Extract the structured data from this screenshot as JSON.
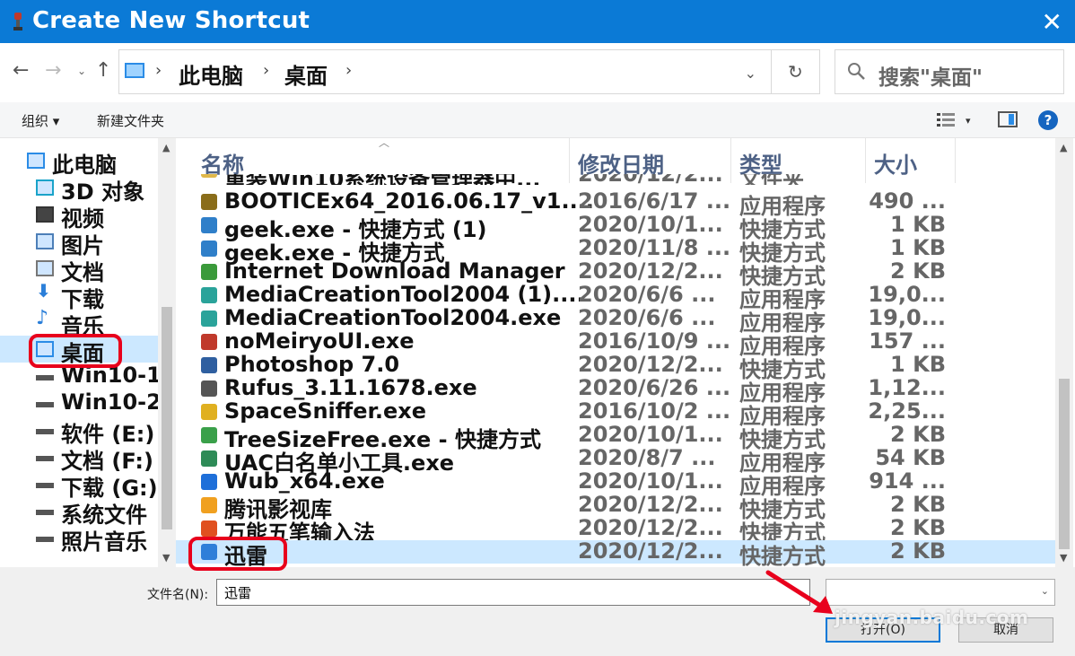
{
  "window": {
    "title": "Create New Shortcut",
    "close_glyph": "✕"
  },
  "nav": {
    "back_glyph": "←",
    "forward_glyph": "→",
    "recent_glyph": "⌄",
    "up_glyph": "↑",
    "breadcrumb": [
      "此电脑",
      "桌面"
    ],
    "sep_glyph": "›",
    "address_dropdown_glyph": "⌄",
    "refresh_glyph": "↻",
    "search_placeholder": "搜索\"桌面\""
  },
  "toolbar": {
    "organize_label": "组织 ▾",
    "new_folder_label": "新建文件夹",
    "view_drop_glyph": "▾",
    "help_glyph": "?"
  },
  "tree": {
    "items": [
      {
        "label": "此电脑",
        "icon": "pc-icon",
        "root": true
      },
      {
        "label": "3D 对象",
        "icon": "3d-objects-icon"
      },
      {
        "label": "视频",
        "icon": "video-icon"
      },
      {
        "label": "图片",
        "icon": "pictures-icon"
      },
      {
        "label": "文档",
        "icon": "documents-icon"
      },
      {
        "label": "下载",
        "icon": "download-icon"
      },
      {
        "label": "音乐",
        "icon": "music-icon"
      },
      {
        "label": "桌面",
        "icon": "desktop-icon",
        "selected": true
      },
      {
        "label": "Win10-1",
        "icon": "drive-icon"
      },
      {
        "label": "Win10-2",
        "icon": "drive-icon"
      },
      {
        "label": "软件 (E:)",
        "icon": "drive-icon"
      },
      {
        "label": "文档 (F:)",
        "icon": "drive-icon"
      },
      {
        "label": "下载 (G:)",
        "icon": "drive-icon"
      },
      {
        "label": "系统文件",
        "icon": "drive-icon"
      },
      {
        "label": "照片音乐",
        "icon": "drive-icon"
      }
    ]
  },
  "list": {
    "columns": [
      "名称",
      "修改日期",
      "类型",
      "大小"
    ],
    "partial_row": {
      "name": "重装Win10系统设备管理器中...",
      "date": "2020/12/2...",
      "type": "文件夹"
    },
    "rows": [
      {
        "name": "BOOTICEx64_2016.06.17_v1....",
        "date": "2016/6/17 ...",
        "type": "应用程序",
        "size": "490 ...",
        "color": "#8a6d1a"
      },
      {
        "name": "geek.exe - 快捷方式 (1)",
        "date": "2020/10/1...",
        "type": "快捷方式",
        "size": "1 KB",
        "color": "#2f7fc9"
      },
      {
        "name": "geek.exe - 快捷方式",
        "date": "2020/11/8 ...",
        "type": "快捷方式",
        "size": "1 KB",
        "color": "#2f7fc9"
      },
      {
        "name": "Internet Download Manager",
        "date": "2020/12/2...",
        "type": "快捷方式",
        "size": "2 KB",
        "color": "#3a9a3a"
      },
      {
        "name": "MediaCreationTool2004 (1)....",
        "date": "2020/6/6 ...",
        "type": "应用程序",
        "size": "19,0...",
        "color": "#2aa39a"
      },
      {
        "name": "MediaCreationTool2004.exe",
        "date": "2020/6/6 ...",
        "type": "应用程序",
        "size": "19,0...",
        "color": "#2aa39a"
      },
      {
        "name": "noMeiryoUI.exe",
        "date": "2016/10/9 ...",
        "type": "应用程序",
        "size": "157 ...",
        "color": "#c0392b"
      },
      {
        "name": "Photoshop 7.0",
        "date": "2020/12/2...",
        "type": "快捷方式",
        "size": "1 KB",
        "color": "#2f5fa0"
      },
      {
        "name": "Rufus_3.11.1678.exe",
        "date": "2020/6/26 ...",
        "type": "应用程序",
        "size": "1,12...",
        "color": "#555555"
      },
      {
        "name": "SpaceSniffer.exe",
        "date": "2016/10/2 ...",
        "type": "应用程序",
        "size": "2,25...",
        "color": "#e0b020"
      },
      {
        "name": "TreeSizeFree.exe - 快捷方式",
        "date": "2020/10/1...",
        "type": "快捷方式",
        "size": "2 KB",
        "color": "#3aa04a"
      },
      {
        "name": "UAC白名单小工具.exe",
        "date": "2020/8/7 ...",
        "type": "应用程序",
        "size": "54 KB",
        "color": "#2e8b57"
      },
      {
        "name": "Wub_x64.exe",
        "date": "2020/10/1...",
        "type": "应用程序",
        "size": "914 ...",
        "color": "#1e6fd9"
      },
      {
        "name": "腾讯影视库",
        "date": "2020/12/2...",
        "type": "快捷方式",
        "size": "2 KB",
        "color": "#f0a020"
      },
      {
        "name": "万能五笔输入法",
        "date": "2020/12/2...",
        "type": "快捷方式",
        "size": "2 KB",
        "color": "#e05020"
      },
      {
        "name": "迅雷",
        "date": "2020/12/2...",
        "type": "快捷方式",
        "size": "2 KB",
        "color": "#2f7fd9",
        "selected": true
      }
    ]
  },
  "bottom": {
    "filename_label": "文件名(N):",
    "filename_value": "迅雷",
    "filetype_drop_glyph": "⌄",
    "open_label": "打开(O)",
    "cancel_label": "取消",
    "watermark": "jingyan.baidu.com"
  },
  "colors": {
    "titlebar": "#0b7ad6",
    "selection": "#cce8ff",
    "highlight": "#e8001c",
    "header_text": "#4d6185"
  }
}
